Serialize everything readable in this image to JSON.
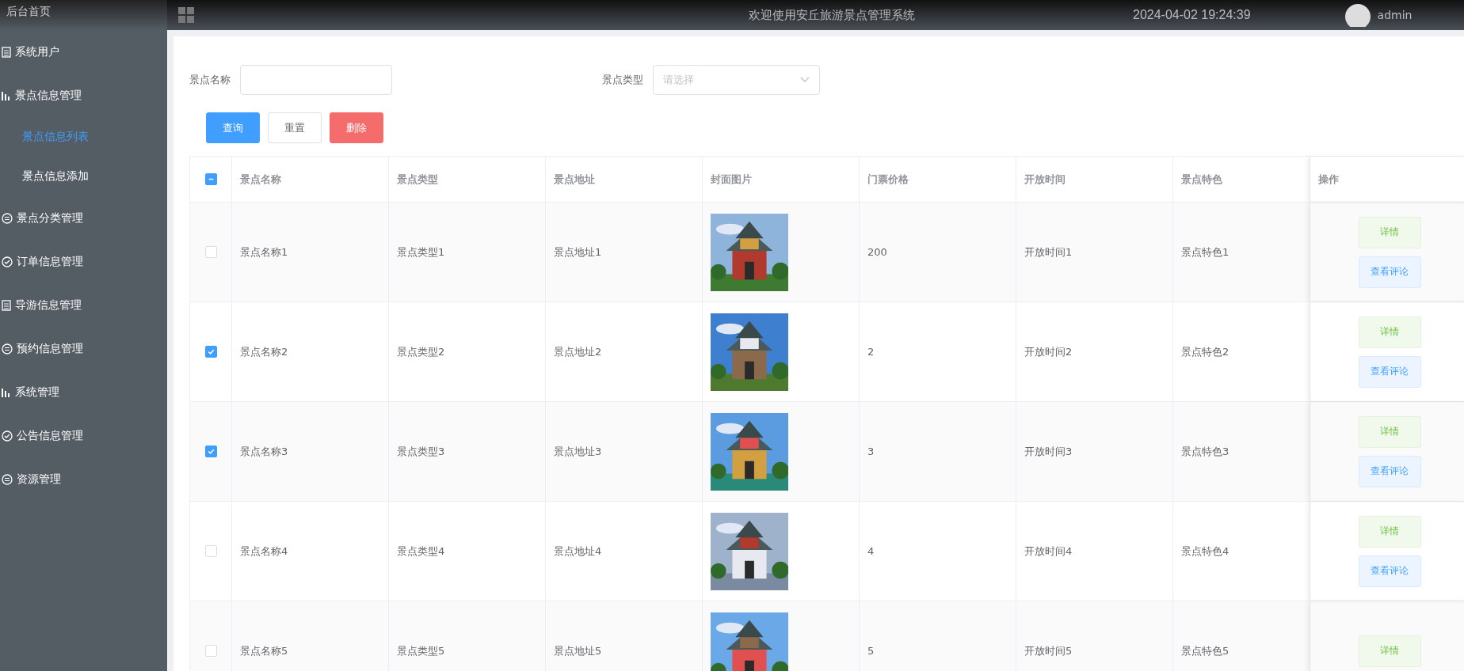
{
  "sidebar": {
    "home": "后台首页",
    "items": [
      {
        "label": "系统用户",
        "kind": "list"
      },
      {
        "label": "景点信息管理",
        "kind": "bars",
        "children": [
          {
            "label": "景点信息列表",
            "selected": true
          },
          {
            "label": "景点信息添加",
            "selected": false
          }
        ]
      },
      {
        "label": "景点分类管理",
        "kind": "circle"
      },
      {
        "label": "订单信息管理",
        "kind": "check"
      },
      {
        "label": "导游信息管理",
        "kind": "list"
      },
      {
        "label": "预约信息管理",
        "kind": "circle"
      },
      {
        "label": "系统管理",
        "kind": "bars"
      },
      {
        "label": "公告信息管理",
        "kind": "check"
      },
      {
        "label": "资源管理",
        "kind": "circle"
      }
    ]
  },
  "header": {
    "title": "欢迎使用安丘旅游景点管理系统",
    "datetime": "2024-04-02 19:24:39",
    "user": "admin"
  },
  "filters": [
    {
      "label": "景点名称",
      "kind": "input"
    },
    {
      "label": "景点类型",
      "kind": "select",
      "placeholder": "请选择"
    }
  ],
  "buttons": [
    {
      "label": "查询",
      "kind": "primary"
    },
    {
      "label": "重置",
      "kind": "plain"
    },
    {
      "label": "删除",
      "kind": "danger"
    }
  ],
  "table": {
    "select_all": {
      "indeterminate": true
    },
    "columns": [
      "景点名称",
      "景点类型",
      "景点地址",
      "封面图片",
      "门票价格",
      "开放时间",
      "景点特色",
      "操作"
    ],
    "rows": [
      {
        "checked": false,
        "cells": [
          "景点名称1",
          "景点类型1",
          "景点地址1"
        ],
        "image": {
          "kind": "picture"
        },
        "rest": [
          "200",
          "开放时间1",
          "景点特色1"
        ],
        "actions": [
          "详情",
          "查看评论"
        ]
      },
      {
        "checked": true,
        "cells": [
          "景点名称2",
          "景点类型2",
          "景点地址2"
        ],
        "image": {
          "kind": "picture"
        },
        "rest": [
          "2",
          "开放时间2",
          "景点特色2"
        ],
        "actions": [
          "详情",
          "查看评论"
        ]
      },
      {
        "checked": true,
        "cells": [
          "景点名称3",
          "景点类型3",
          "景点地址3"
        ],
        "image": {
          "kind": "picture"
        },
        "rest": [
          "3",
          "开放时间3",
          "景点特色3"
        ],
        "actions": [
          "详情",
          "查看评论"
        ]
      },
      {
        "checked": false,
        "cells": [
          "景点名称4",
          "景点类型4",
          "景点地址4"
        ],
        "image": {
          "kind": "picture"
        },
        "rest": [
          "4",
          "开放时间4",
          "景点特色4"
        ],
        "actions": [
          "详情",
          "查看评论"
        ]
      },
      {
        "checked": false,
        "cells": [
          "景点名称5",
          "景点类型5",
          "景点地址5"
        ],
        "image": {
          "kind": "picture"
        },
        "rest": [
          "5",
          "开放时间5",
          "景点特色5"
        ],
        "actions": [
          "详情"
        ]
      }
    ]
  }
}
